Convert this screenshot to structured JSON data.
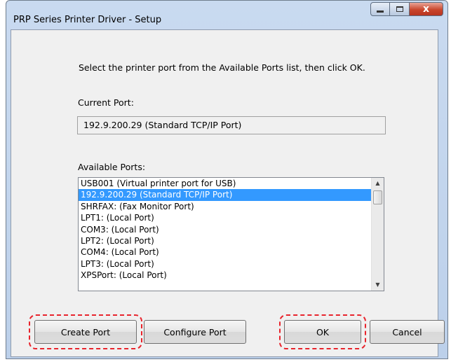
{
  "window": {
    "title": "PRP Series Printer Driver - Setup",
    "close_glyph": "x"
  },
  "main": {
    "instruction": "Select the printer port from the Available Ports list, then click OK.",
    "current_port_label": "Current Port:",
    "current_port_value": "192.9.200.29 (Standard TCP/IP Port)",
    "available_ports_label": "Available Ports:",
    "available_ports": [
      "USB001 (Virtual printer port for USB)",
      "192.9.200.29 (Standard TCP/IP Port)",
      "SHRFAX: (Fax Monitor Port)",
      "LPT1: (Local Port)",
      "COM3: (Local Port)",
      "LPT2: (Local Port)",
      "COM4: (Local Port)",
      "LPT3: (Local Port)",
      "XPSPort: (Local Port)"
    ],
    "selected_port": "192.9.200.29 (Standard TCP/IP Port)"
  },
  "buttons": {
    "create_port": "Create Port",
    "configure_port": "Configure Port",
    "ok": "OK",
    "cancel": "Cancel"
  },
  "colors": {
    "selection": "#3399ff",
    "highlight_dash": "#e8242c"
  }
}
